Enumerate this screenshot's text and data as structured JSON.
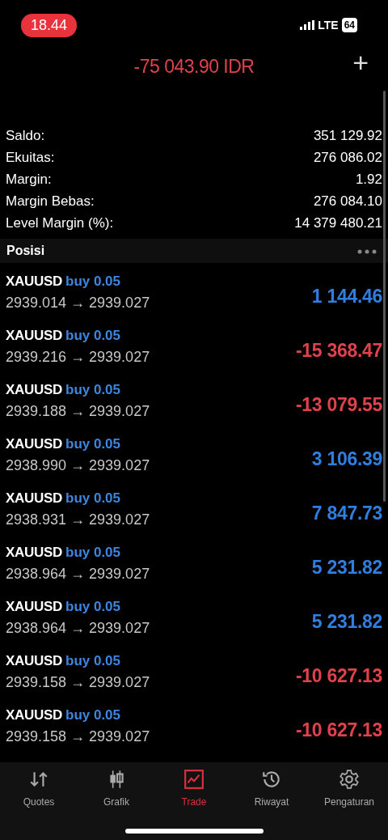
{
  "status_bar": {
    "time": "18.44",
    "network": "LTE",
    "battery": "64"
  },
  "header": {
    "title": "-75 043.90 IDR",
    "add_button": "+"
  },
  "summary": [
    {
      "label": "Saldo:",
      "value": "351 129.92"
    },
    {
      "label": "Ekuitas:",
      "value": "276 086.02"
    },
    {
      "label": "Margin:",
      "value": "1.92"
    },
    {
      "label": "Margin Bebas:",
      "value": "276 084.10"
    },
    {
      "label": "Level Margin (%):",
      "value": "14 379 480.21"
    }
  ],
  "positions_header": {
    "title": "Posisi"
  },
  "positions": [
    {
      "symbol": "XAUUSD",
      "type": "buy 0.05",
      "prices": "2939.014 → 2939.027",
      "profit": "1 144.46",
      "kind": "profit"
    },
    {
      "symbol": "XAUUSD",
      "type": "buy 0.05",
      "prices": "2939.216 → 2939.027",
      "profit": "-15 368.47",
      "kind": "loss"
    },
    {
      "symbol": "XAUUSD",
      "type": "buy 0.05",
      "prices": "2939.188 → 2939.027",
      "profit": "-13 079.55",
      "kind": "loss"
    },
    {
      "symbol": "XAUUSD",
      "type": "buy 0.05",
      "prices": "2938.990 → 2939.027",
      "profit": "3 106.39",
      "kind": "profit"
    },
    {
      "symbol": "XAUUSD",
      "type": "buy 0.05",
      "prices": "2938.931 → 2939.027",
      "profit": "7 847.73",
      "kind": "profit"
    },
    {
      "symbol": "XAUUSD",
      "type": "buy 0.05",
      "prices": "2938.964 → 2939.027",
      "profit": "5 231.82",
      "kind": "profit"
    },
    {
      "symbol": "XAUUSD",
      "type": "buy 0.05",
      "prices": "2938.964 → 2939.027",
      "profit": "5 231.82",
      "kind": "profit"
    },
    {
      "symbol": "XAUUSD",
      "type": "buy 0.05",
      "prices": "2939.158 → 2939.027",
      "profit": "-10 627.13",
      "kind": "loss"
    },
    {
      "symbol": "XAUUSD",
      "type": "buy 0.05",
      "prices": "2939.158 → 2939.027",
      "profit": "-10 627.13",
      "kind": "loss"
    }
  ],
  "tab_bar": [
    {
      "label": "Quotes",
      "kind": "quotes",
      "selected": false
    },
    {
      "label": "Grafik",
      "kind": "chart",
      "selected": false
    },
    {
      "label": "Trade",
      "kind": "trade",
      "selected": true
    },
    {
      "label": "Riwayat",
      "kind": "history",
      "selected": false
    },
    {
      "label": "Pengaturan",
      "kind": "settings",
      "selected": false
    }
  ]
}
